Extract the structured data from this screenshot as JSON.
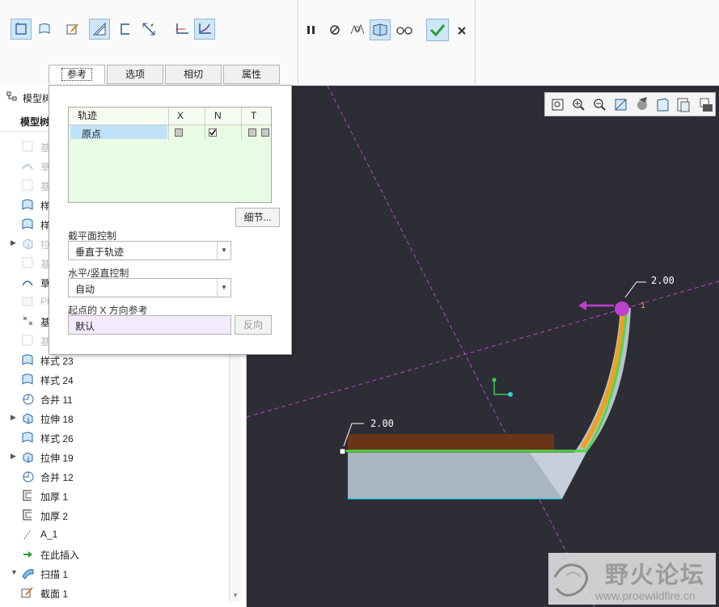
{
  "ribbon": {
    "tabs": [
      {
        "label": "参考",
        "active": true
      },
      {
        "label": "选项",
        "active": false
      },
      {
        "label": "相切",
        "active": false
      },
      {
        "label": "属性",
        "active": false
      }
    ],
    "tools": [
      "solid-icon",
      "surface-icon",
      "sketch-edit-icon",
      "remove-material-icon",
      "thin-icon",
      "stretch-icon",
      "constant-section-icon",
      "variable-section-icon"
    ],
    "controls": [
      "pause-icon",
      "no-preview-icon",
      "verify-mode-icon",
      "feature-preview-icon",
      "glasses-icon",
      "ok-check-icon",
      "cancel-x-icon"
    ]
  },
  "model_tree": {
    "header_title": "模型树",
    "column_header": "模型树",
    "items": [
      {
        "label": "基",
        "faded": true,
        "icon": "datum-plane-icon",
        "expand": false
      },
      {
        "label": "草",
        "faded": true,
        "icon": "sketch-icon",
        "expand": false
      },
      {
        "label": "基",
        "faded": true,
        "icon": "datum-plane-icon",
        "expand": false
      },
      {
        "label": "样",
        "faded": false,
        "icon": "style-surface-icon",
        "expand": false
      },
      {
        "label": "样",
        "faded": false,
        "icon": "style-surface-icon",
        "expand": false
      },
      {
        "label": "拉",
        "faded": true,
        "icon": "extrude-icon",
        "expand": true
      },
      {
        "label": "基",
        "faded": true,
        "icon": "datum-plane-icon",
        "expand": false
      },
      {
        "label": "草",
        "faded": false,
        "icon": "sketch-icon",
        "expand": false
      },
      {
        "label": "Pl",
        "faded": true,
        "icon": "plane-icon",
        "expand": false
      },
      {
        "label": "基",
        "faded": false,
        "icon": "datum-point-icon",
        "expand": false
      },
      {
        "label": "基",
        "faded": true,
        "icon": "datum-plane-icon",
        "expand": false
      },
      {
        "label": "样式 23",
        "faded": false,
        "icon": "style-surface-icon",
        "expand": false
      },
      {
        "label": "样式 24",
        "faded": false,
        "icon": "style-surface-icon",
        "expand": false
      },
      {
        "label": "合并 11",
        "faded": false,
        "icon": "merge-icon",
        "expand": false
      },
      {
        "label": "拉伸 18",
        "faded": false,
        "icon": "extrude-icon",
        "expand": true
      },
      {
        "label": "样式 26",
        "faded": false,
        "icon": "style-surface-icon",
        "expand": false
      },
      {
        "label": "拉伸 19",
        "faded": false,
        "icon": "extrude-icon",
        "expand": true
      },
      {
        "label": "合并 12",
        "faded": false,
        "icon": "merge-icon",
        "expand": false
      },
      {
        "label": "加厚 1",
        "faded": false,
        "icon": "thicken-icon",
        "expand": false
      },
      {
        "label": "加厚 2",
        "faded": false,
        "icon": "thicken-icon",
        "expand": false
      },
      {
        "label": "A_1",
        "faded": false,
        "icon": "axis-icon",
        "expand": false
      },
      {
        "label": "在此插入",
        "faded": false,
        "icon": "insert-here-arrow-icon",
        "expand": false
      },
      {
        "label": "扫描 1",
        "faded": false,
        "icon": "sweep-icon",
        "expand": "open"
      },
      {
        "label": "截面 1",
        "faded": false,
        "icon": "section-sketch-icon",
        "expand": false
      }
    ]
  },
  "references_panel": {
    "trajectories_header": {
      "name": "轨迹",
      "x": "X",
      "n": "N",
      "t": "T"
    },
    "trajectory_rows": [
      {
        "name": "原点",
        "x_checked": false,
        "n_checked": true
      }
    ],
    "details_button": "细节...",
    "section_plane_label": "截平面控制",
    "section_plane_value": "垂直于轨迹",
    "hv_control_label": "水平/竖直控制",
    "hv_control_value": "自动",
    "x_ref_label": "起点的 X 方向参考",
    "x_ref_value": "默认",
    "flip_button": "反向"
  },
  "viewport": {
    "dim_top": "2.00",
    "dim_left": "2.00",
    "origin_label": "1",
    "tools": [
      "refit-icon",
      "zoom-in-icon",
      "zoom-out-icon",
      "repaint-icon",
      "display-style-icon",
      "saved-views-icon",
      "view-manager-icon",
      "datum-display-icon"
    ]
  },
  "watermark": {
    "title": "野火论坛",
    "url": "www.proewildfire.cn"
  },
  "colors": {
    "viewport_bg": "#2d2d36",
    "trajectory_green": "#4fd84a",
    "accent_orange": "#f0a020",
    "datum_magenta": "#b44cc8"
  }
}
